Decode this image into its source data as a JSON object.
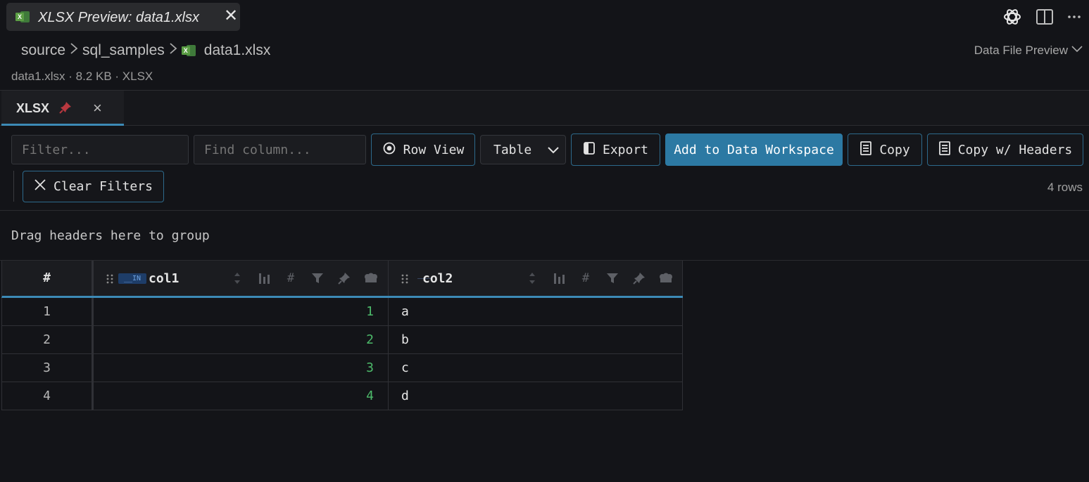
{
  "editor_tab": {
    "title": "XLSX Preview: data1.xlsx",
    "close": "✕"
  },
  "breadcrumb": {
    "items": [
      "source",
      "sql_samples",
      "data1.xlsx"
    ],
    "separator": ">"
  },
  "preview_mode": {
    "label": "Data File Preview"
  },
  "file_meta": "data1.xlsx · 8.2 KB · XLSX",
  "sheet_tabs": [
    {
      "label": "XLSX",
      "close": "×"
    }
  ],
  "toolbar": {
    "filter_placeholder": "Filter...",
    "find_column_placeholder": "Find column...",
    "row_view": "Row View",
    "view_select": "Table",
    "export": "Export",
    "add_to_workspace": "Add to Data Workspace",
    "copy": "Copy",
    "copy_headers": "Copy w/ Headers",
    "clear_filters": "Clear Filters",
    "row_count": "4 rows"
  },
  "group_zone": "Drag headers here to group",
  "grid": {
    "row_header": "#",
    "columns": [
      {
        "name": "col1",
        "type_badge": "__IN"
      },
      {
        "name": "col2",
        "type_badge": ""
      }
    ],
    "header_icon_glyph": "#",
    "rows": [
      {
        "n": "1",
        "col1": "1",
        "col2": "a"
      },
      {
        "n": "2",
        "col1": "2",
        "col2": "b"
      },
      {
        "n": "3",
        "col1": "3",
        "col2": "c"
      },
      {
        "n": "4",
        "col1": "4",
        "col2": "d"
      }
    ]
  },
  "colors": {
    "accent": "#2c79a3",
    "tab_underline": "#3c8ab6",
    "number": "#4dbb6b",
    "background": "#131418"
  },
  "icons": [
    "excel-file-icon",
    "openai-icon",
    "split-editor-icon",
    "more-icon",
    "pin-icon",
    "eye-icon",
    "export-icon",
    "copy-icon",
    "x-icon",
    "sort-icon",
    "chart-icon",
    "filter-icon",
    "pin-column-icon",
    "group-icon"
  ]
}
